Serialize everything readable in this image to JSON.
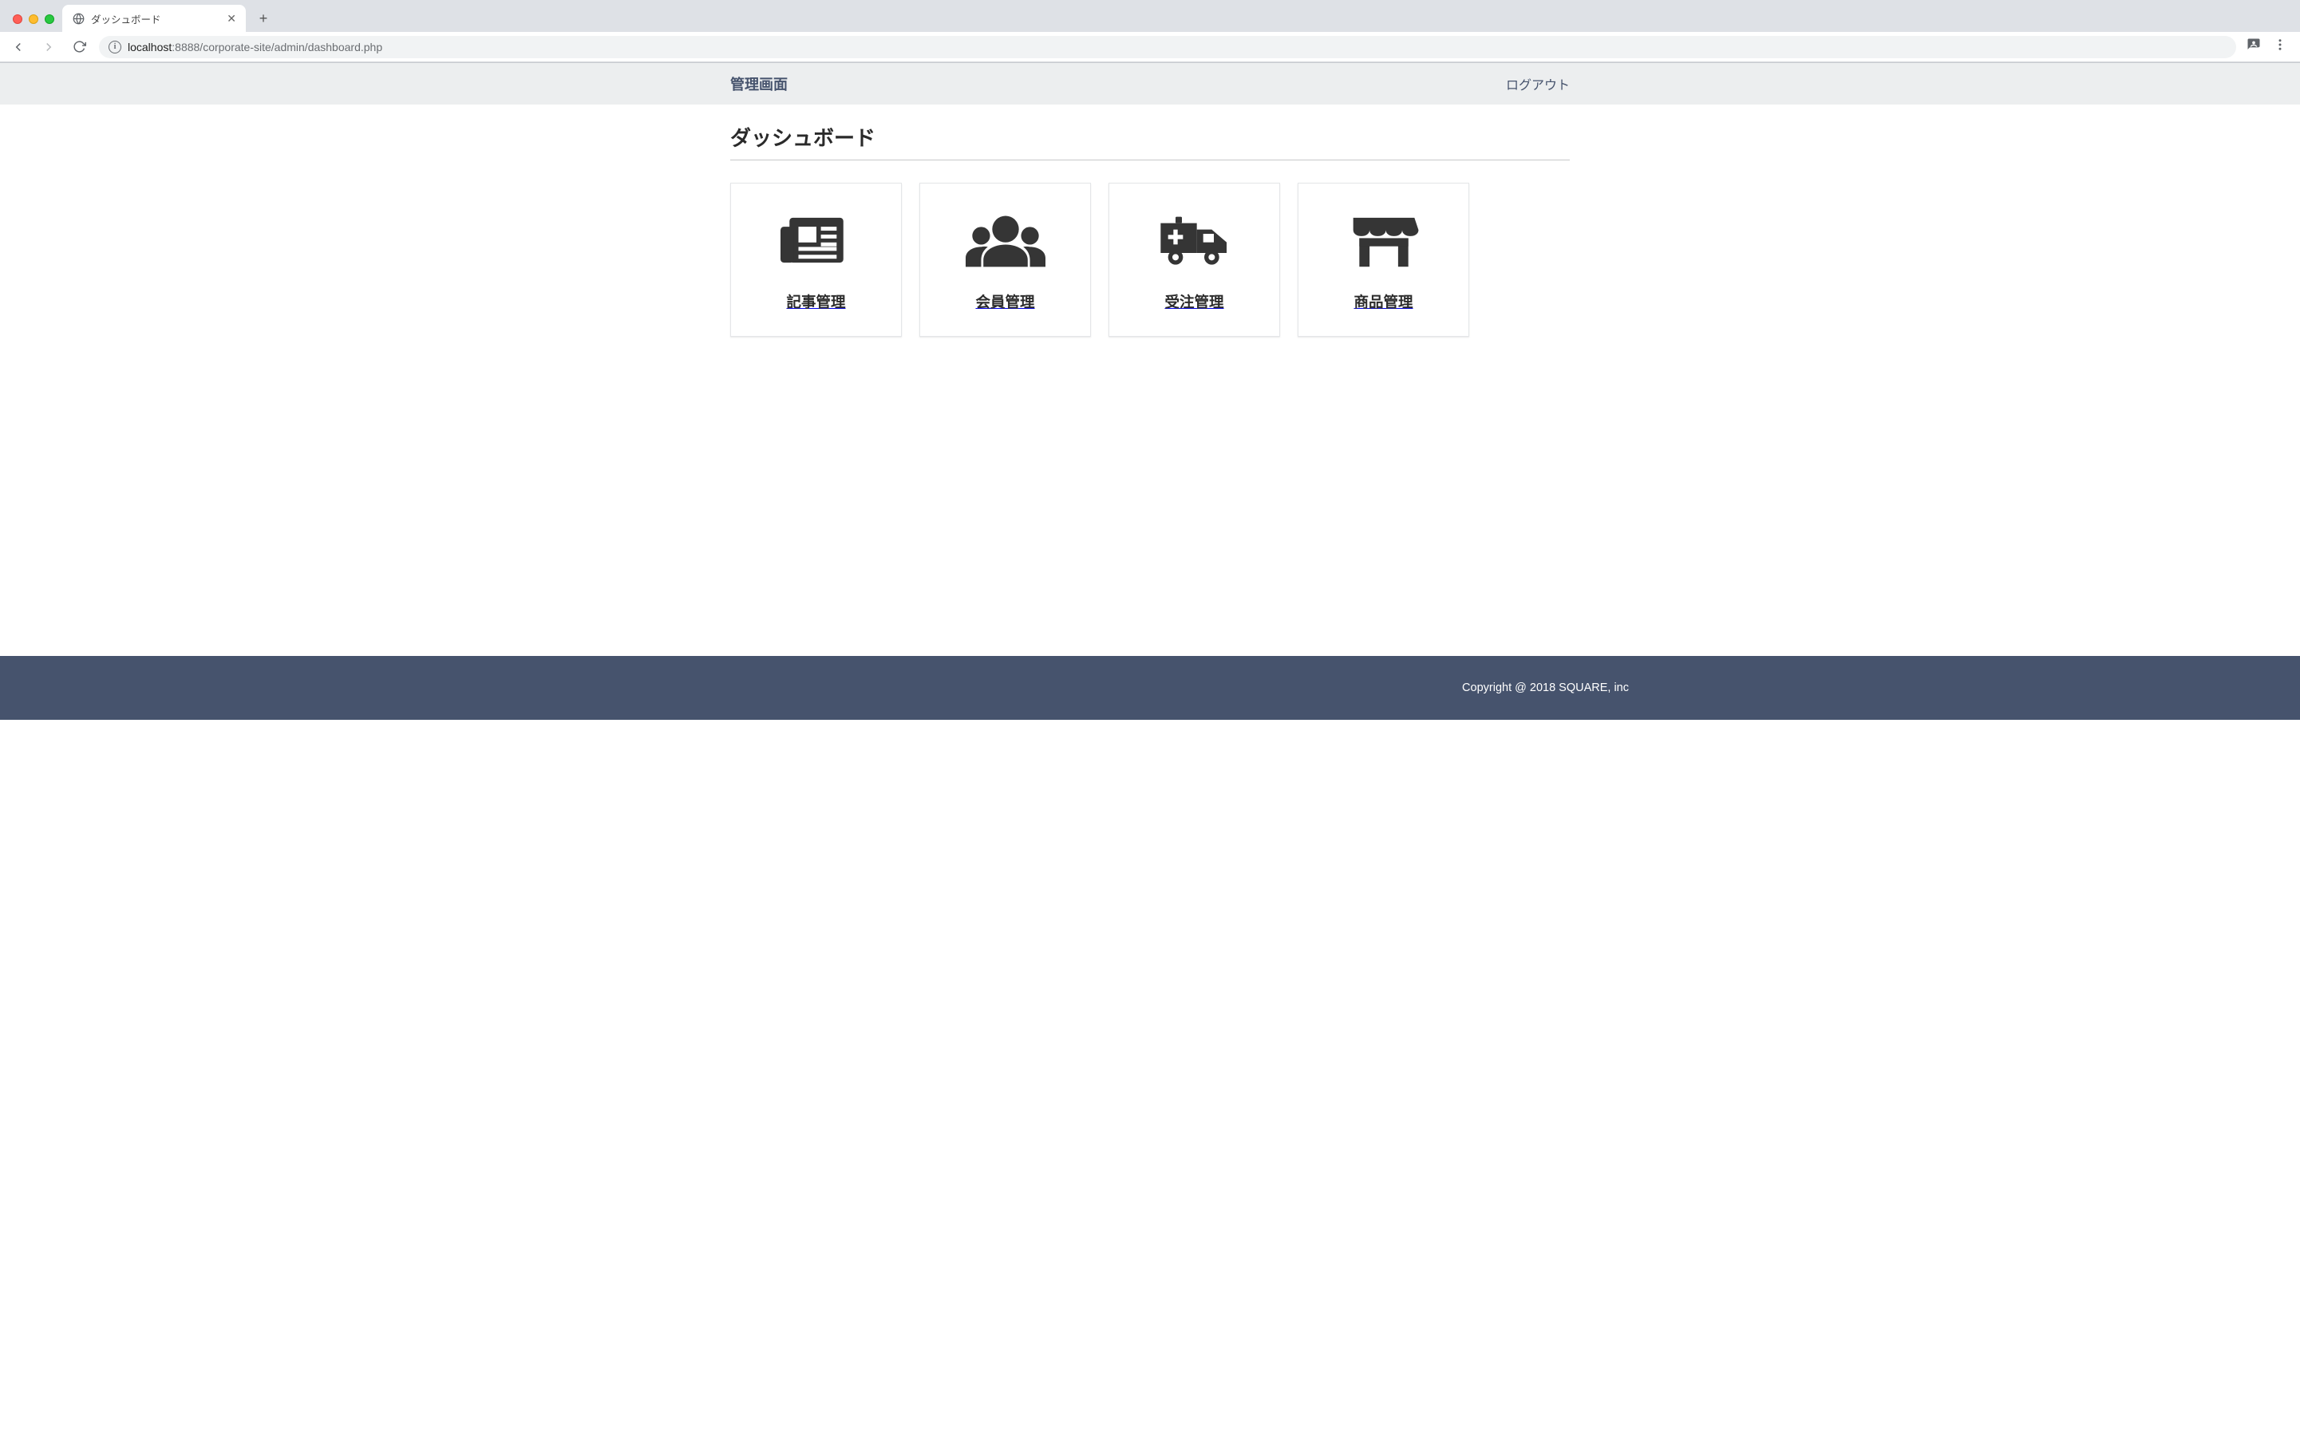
{
  "browser": {
    "tab_title": "ダッシュボード",
    "url_host": "localhost",
    "url_port_path": ":8888/corporate-site/admin/dashboard.php"
  },
  "header": {
    "brand": "管理画面",
    "logout_label": "ログアウト"
  },
  "page": {
    "title": "ダッシュボード"
  },
  "cards": [
    {
      "label": "記事管理",
      "icon": "newspaper"
    },
    {
      "label": "会員管理",
      "icon": "users"
    },
    {
      "label": "受注管理",
      "icon": "ambulance"
    },
    {
      "label": "商品管理",
      "icon": "store"
    }
  ],
  "footer": {
    "copyright": "Copyright @ 2018 SQUARE, inc"
  }
}
